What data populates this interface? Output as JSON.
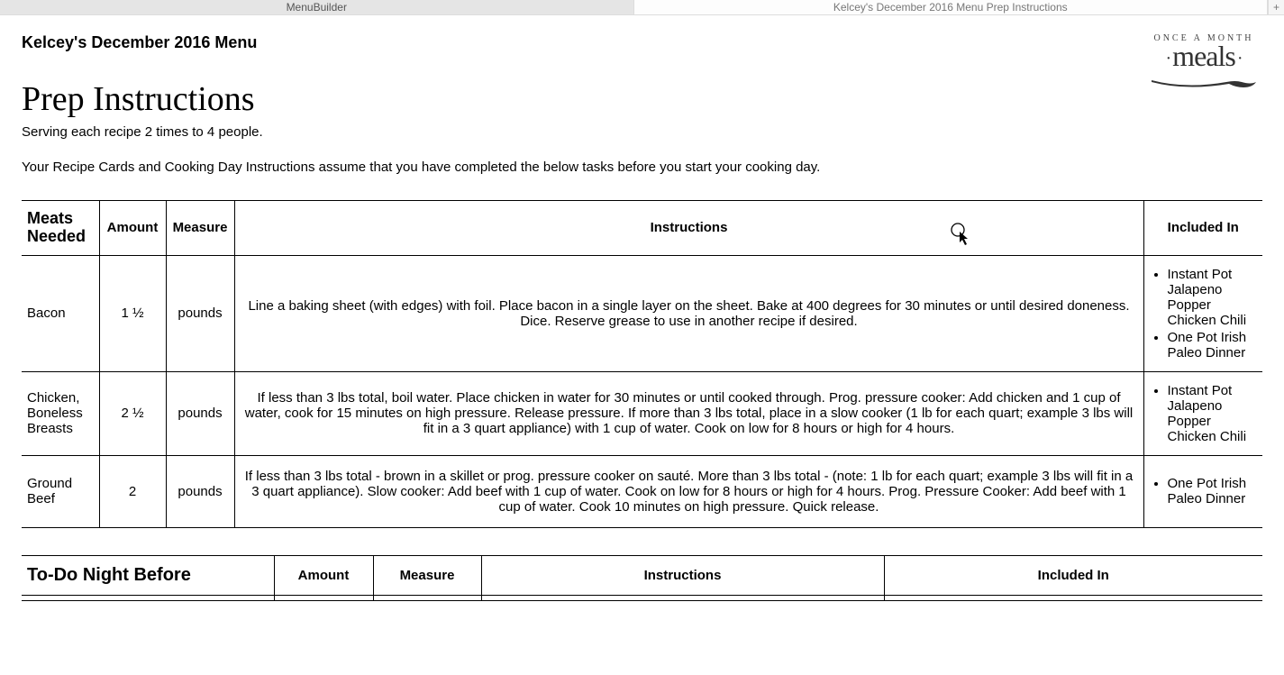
{
  "tabs": {
    "tab1": "MenuBuilder",
    "tab2": "Kelcey's December 2016 Menu Prep Instructions"
  },
  "logo": {
    "arc_text": "ONCE A MONTH",
    "word": "meals"
  },
  "menu_title": "Kelcey's December 2016 Menu",
  "page_title": "Prep Instructions",
  "subtitle": "Serving each recipe 2 times to 4 people.",
  "intro": "Your Recipe Cards and Cooking Day Instructions assume that you have completed the below tasks before you start your cooking day.",
  "meats_table": {
    "headers": {
      "name": "Meats Needed",
      "amount": "Amount",
      "measure": "Measure",
      "instructions": "Instructions",
      "included": "Included In"
    },
    "rows": [
      {
        "name": "Bacon",
        "amount": "1 ½",
        "measure": "pounds",
        "instructions": "Line a baking sheet (with edges) with foil. Place bacon in a single layer on the sheet. Bake at 400 degrees for 30 minutes or until desired doneness. Dice. Reserve grease to use in another recipe if desired.",
        "included": [
          "Instant Pot Jalapeno Popper Chicken Chili",
          "One Pot Irish Paleo Dinner"
        ]
      },
      {
        "name": "Chicken, Boneless Breasts",
        "amount": "2 ½",
        "measure": "pounds",
        "instructions": "If less than 3 lbs total, boil water. Place chicken in water for 30 minutes or until cooked through. Prog. pressure cooker: Add chicken and 1 cup of water, cook for 15 minutes on high pressure. Release pressure. If more than 3 lbs total, place in a slow cooker (1 lb for each quart; example 3 lbs will fit in a 3 quart appliance) with 1 cup of water. Cook on low for 8 hours or high for 4 hours.",
        "included": [
          "Instant Pot Jalapeno Popper Chicken Chili"
        ]
      },
      {
        "name": "Ground Beef",
        "amount": "2",
        "measure": "pounds",
        "instructions": "If less than 3 lbs total - brown in a skillet or prog. pressure cooker on sauté. More than 3 lbs total - (note: 1 lb for each quart; example 3 lbs will fit in a 3 quart appliance). Slow cooker: Add beef with 1 cup of water. Cook on low for 8 hours or high for 4 hours. Prog. Pressure Cooker: Add beef with 1 cup of water. Cook 10 minutes on high pressure. Quick release.",
        "included": [
          "One Pot Irish Paleo Dinner"
        ]
      }
    ]
  },
  "todo_table": {
    "headers": {
      "title": "To-Do Night Before",
      "amount": "Amount",
      "measure": "Measure",
      "instructions": "Instructions",
      "included": "Included In"
    }
  }
}
